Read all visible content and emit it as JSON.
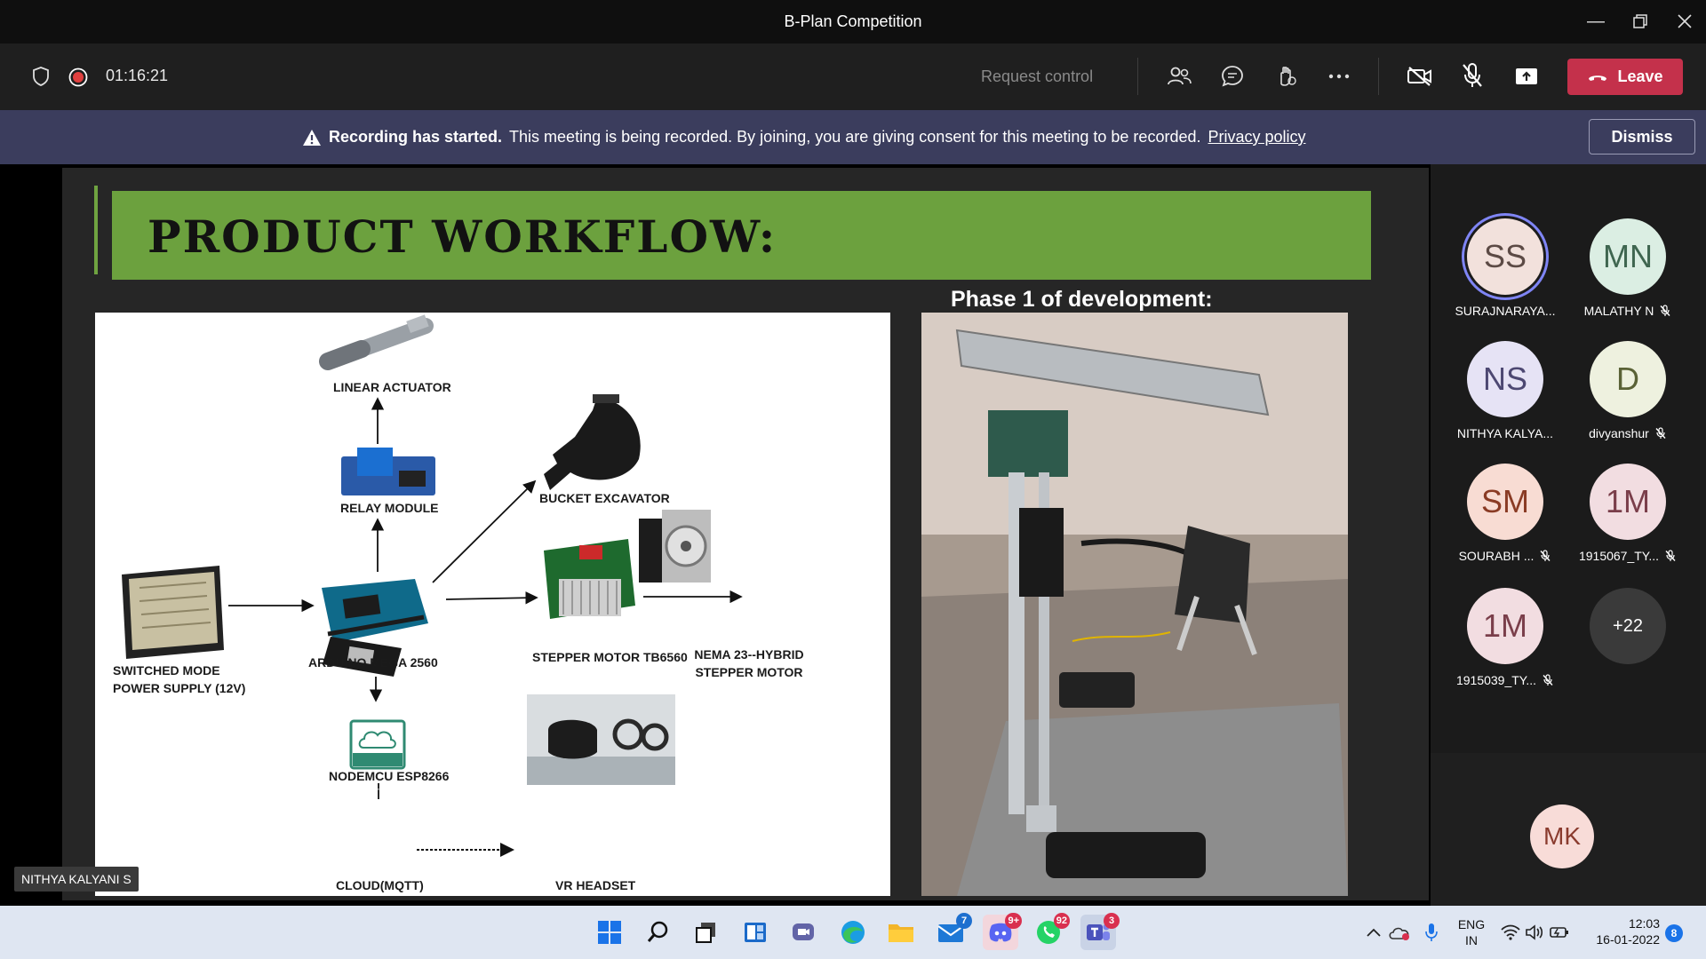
{
  "window": {
    "title": "B-Plan Competition"
  },
  "toolbar": {
    "timer": "01:16:21",
    "request_control_label": "Request control",
    "leave_label": "Leave"
  },
  "banner": {
    "bold": "Recording has started.",
    "text": "This meeting is being recorded. By joining, you are giving consent for this meeting to be recorded.",
    "link": "Privacy policy",
    "dismiss_label": "Dismiss"
  },
  "slide": {
    "title": "PRODUCT WORKFLOW:",
    "phase_label": "Phase 1 of development:",
    "diagram": {
      "linear_actuator": "LINEAR ACTUATOR",
      "relay_module": "RELAY MODULE",
      "bucket_excavator": "BUCKET EXCAVATOR",
      "smps_line1": "SWITCHED MODE",
      "smps_line2": "POWER SUPPLY (12V)",
      "arduino": "ARDUINO MEGA 2560",
      "stepper_driver": "STEPPER MOTOR TB6560",
      "nema_line1": "NEMA 23--HYBRID",
      "nema_line2": "STEPPER MOTOR",
      "nodemcu": "NODEMCU ESP8266",
      "cloud": "CLOUD(MQTT)",
      "cloud_icon_text": "MQTT",
      "vr": "VR HEADSET"
    },
    "presenter": "NITHYA KALYANI S"
  },
  "participants": [
    {
      "initials": "SS",
      "name": "SURAJNARAYA...",
      "bg": "#f2e1dc",
      "fg": "#5c4a45",
      "muted": false,
      "speaking": true
    },
    {
      "initials": "MN",
      "name": "MALATHY N",
      "bg": "#dbeee3",
      "fg": "#3f6650",
      "muted": true
    },
    {
      "initials": "NS",
      "name": "NITHYA KALYA...",
      "bg": "#e6e3f5",
      "fg": "#4d4872",
      "muted": false
    },
    {
      "initials": "D",
      "name": "divyanshur",
      "bg": "#eef1df",
      "fg": "#5a6236",
      "muted": true
    },
    {
      "initials": "SM",
      "name": "SOURABH ...",
      "bg": "#f8dcd3",
      "fg": "#8a3b24",
      "muted": true
    },
    {
      "initials": "1M",
      "name": "1915067_TY...",
      "bg": "#f2dde1",
      "fg": "#7a3e4a",
      "muted": true
    },
    {
      "initials": "1M",
      "name": "1915039_TY...",
      "bg": "#f2dde1",
      "fg": "#7a3e4a",
      "muted": true
    },
    {
      "initials": "+22",
      "name": "",
      "bg": "#3a3a3a",
      "fg": "#ffffff",
      "muted": false
    }
  ],
  "self_tile": {
    "initials": "MK",
    "bg": "#f8dcd8",
    "fg": "#8a3b2e"
  },
  "taskbar": {
    "badges": {
      "mail": "7",
      "discord": "9+",
      "whatsapp": "92",
      "teams": "3",
      "notifications": "8"
    },
    "lang_line1": "ENG",
    "lang_line2": "IN",
    "time": "12:03",
    "date": "16-01-2022"
  }
}
